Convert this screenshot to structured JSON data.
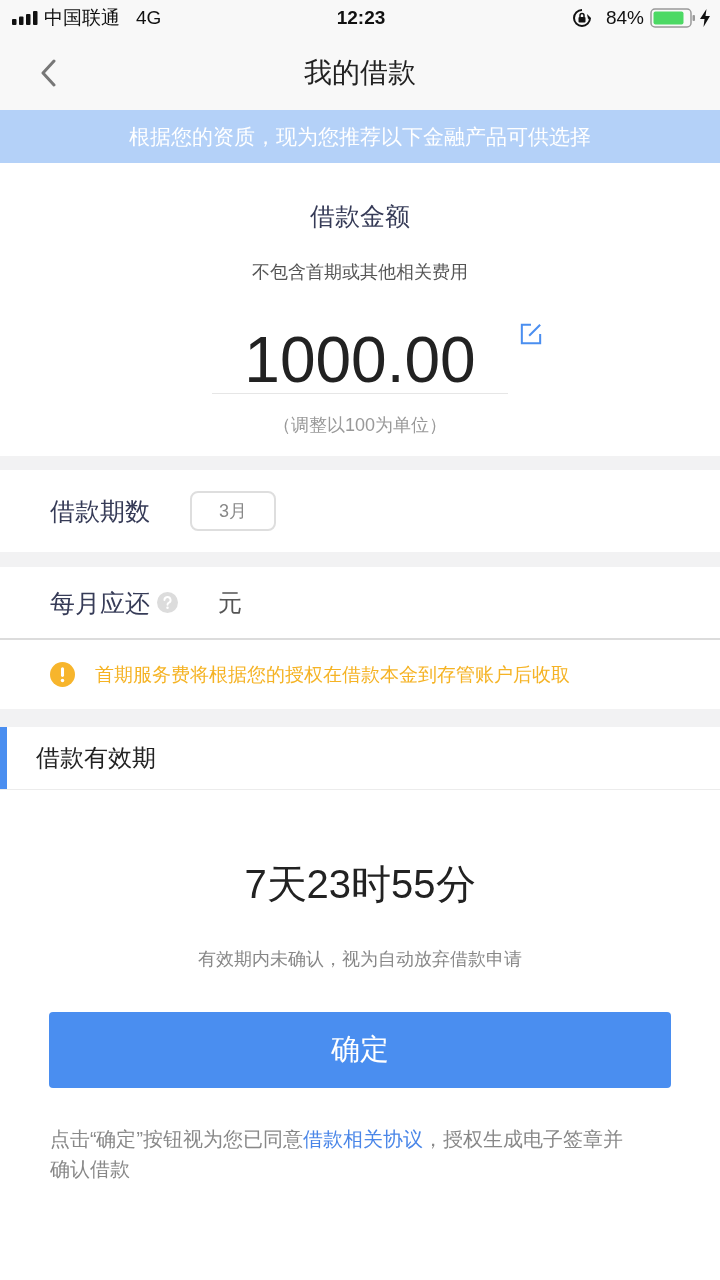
{
  "status_bar": {
    "carrier": "中国联通",
    "network": "4G",
    "time": "12:23",
    "battery": "84%",
    "charging": true
  },
  "nav": {
    "title": "我的借款"
  },
  "banner": {
    "text": "根据您的资质，现为您推荐以下金融产品可供选择"
  },
  "amount": {
    "title": "借款金额",
    "subtitle": "不包含首期或其他相关费用",
    "value": "1000.00",
    "hint": "（调整以100为单位）"
  },
  "term": {
    "label": "借款期数",
    "value": "3月"
  },
  "monthly": {
    "label": "每月应还",
    "unit": "元"
  },
  "notice": {
    "text": "首期服务费将根据您的授权在借款本金到存管账户后收取"
  },
  "validity": {
    "title": "借款有效期",
    "countdown": "7天23时55分",
    "note": "有效期内未确认，视为自动放弃借款申请"
  },
  "confirm_button": {
    "label": "确定"
  },
  "agreement": {
    "before": "点击“确定”按钮视为您已同意",
    "link": "借款相关协议",
    "after": "，授权生成电子签章并确认借款"
  }
}
